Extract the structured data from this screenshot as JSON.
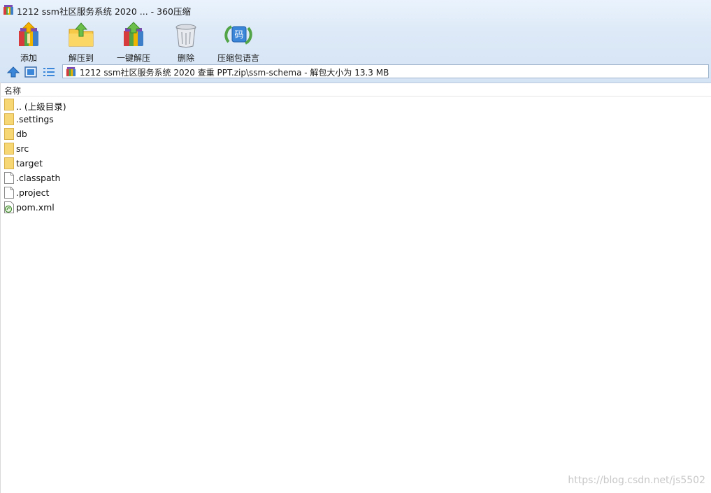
{
  "window": {
    "title": "1212 ssm社区服务系统  2020 ... - 360压缩"
  },
  "toolbar": {
    "items": [
      {
        "label": "添加",
        "icon": "add-archive-icon"
      },
      {
        "label": "解压到",
        "icon": "extract-to-icon"
      },
      {
        "label": "一键解压",
        "icon": "one-click-extract-icon"
      },
      {
        "label": "删除",
        "icon": "trash-icon"
      },
      {
        "label": "压缩包语言",
        "icon": "archive-language-icon"
      }
    ]
  },
  "navigation": {
    "buttons": [
      {
        "icon": "up-arrow-icon"
      },
      {
        "icon": "thumbnail-view-icon"
      },
      {
        "icon": "list-view-icon"
      }
    ],
    "address": "1212 ssm社区服务系统  2020 查重 PPT.zip\\ssm-schema - 解包大小为 13.3 MB"
  },
  "file_list": {
    "column_name": "名称",
    "items": [
      {
        "name": ".. (上级目录)",
        "type": "folder"
      },
      {
        "name": ".settings",
        "type": "folder"
      },
      {
        "name": "db",
        "type": "folder"
      },
      {
        "name": "src",
        "type": "folder"
      },
      {
        "name": "target",
        "type": "folder"
      },
      {
        "name": ".classpath",
        "type": "file"
      },
      {
        "name": ".project",
        "type": "file"
      },
      {
        "name": "pom.xml",
        "type": "xml"
      }
    ]
  },
  "watermark": "https://blog.csdn.net/js5502",
  "colors": {
    "header_top": "#eaf3fd",
    "header_bottom": "#d5e4f5",
    "folder": "#f7d774",
    "accent_blue": "#3b86d8"
  }
}
